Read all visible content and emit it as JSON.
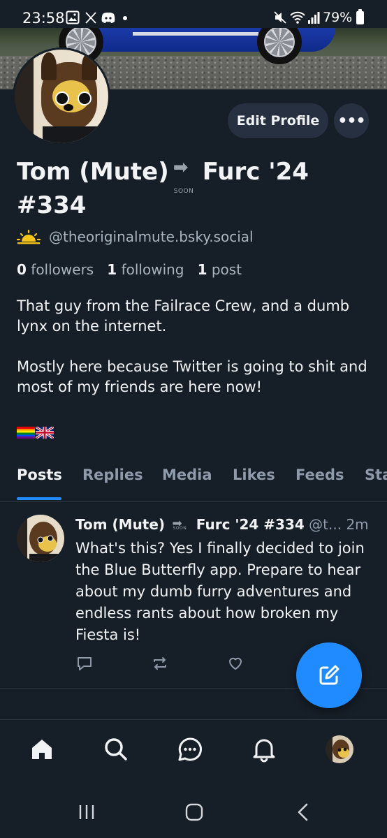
{
  "status_bar": {
    "time": "23:58",
    "battery": "79%"
  },
  "profile": {
    "display_name_part1": "Tom (Mute)",
    "soon_label": "SOON",
    "display_name_part2": "Furc '24",
    "display_name_line2": "#334",
    "handle": "@theoriginalmute.bsky.social",
    "edit_profile_label": "Edit Profile",
    "more_label": "•••",
    "followers_count": "0",
    "followers_label": "followers",
    "following_count": "1",
    "following_label": "following",
    "posts_count": "1",
    "posts_label": "post",
    "bio_line1": "That guy from the Failrace Crew, and a dumb lynx on the internet.",
    "bio_line2": "Mostly here because Twitter is going to shit and most of my friends are here now!"
  },
  "tabs": [
    {
      "label": "Posts"
    },
    {
      "label": "Replies"
    },
    {
      "label": "Media"
    },
    {
      "label": "Likes"
    },
    {
      "label": "Feeds"
    },
    {
      "label": "Sta"
    }
  ],
  "post": {
    "author_part1": "Tom (Mute)",
    "author_part2": "Furc '24 #334",
    "handle": "@t...",
    "time": "2m",
    "text": "What's this? Yes I finally decided to join the Blue Butterfly app. Prepare to hear about my dumb furry adventures and endless rants about how broken my Fiesta is!"
  },
  "colors": {
    "background": "#161e27",
    "accent": "#208bfe",
    "button_bg": "#263040",
    "muted_text": "#8f9bab"
  },
  "icons": {
    "post_actions": [
      "reply-icon",
      "repost-icon",
      "like-icon"
    ],
    "bottom_nav": [
      "home-icon",
      "search-icon",
      "chat-icon",
      "notifications-icon",
      "profile-avatar"
    ],
    "system_nav": [
      "recents-icon",
      "home-button-icon",
      "back-icon"
    ]
  }
}
